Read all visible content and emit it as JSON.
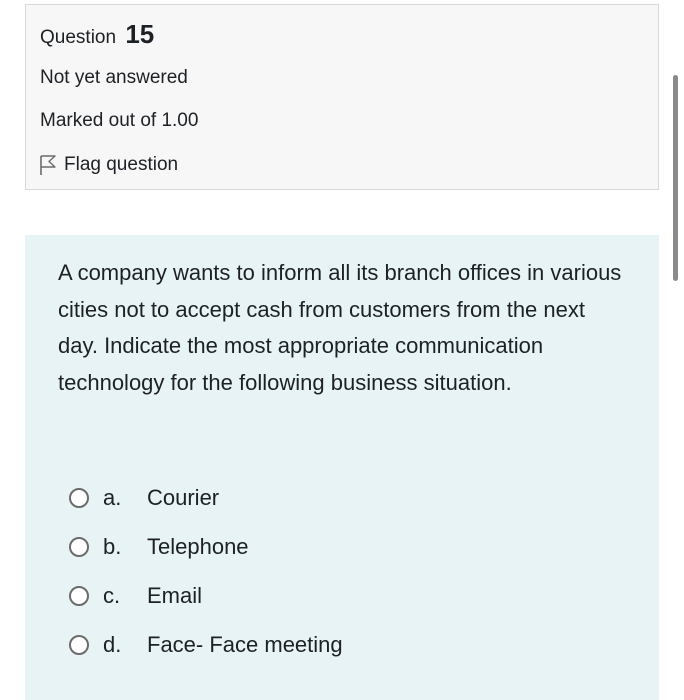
{
  "question": {
    "label": "Question",
    "number": "15",
    "state": "Not yet answered",
    "grade": "Marked out of 1.00",
    "flag_label": "Flag question"
  },
  "content": {
    "text": "A company wants to inform all its branch offices in various cities not to accept cash from customers from the next day. Indicate the most appropriate communication technology for the following business situation.",
    "answers": [
      {
        "letter": "a.",
        "text": "Courier"
      },
      {
        "letter": "b.",
        "text": "Telephone"
      },
      {
        "letter": "c.",
        "text": "Email"
      },
      {
        "letter": "d.",
        "text": "Face- Face meeting"
      }
    ]
  },
  "colors": {
    "info_bg": "#f7f7f7",
    "content_bg": "#e7f3f5",
    "text": "#1d2125"
  },
  "icons": {
    "flag": "flag-outline-icon",
    "radio": "radio-unchecked-icon"
  }
}
